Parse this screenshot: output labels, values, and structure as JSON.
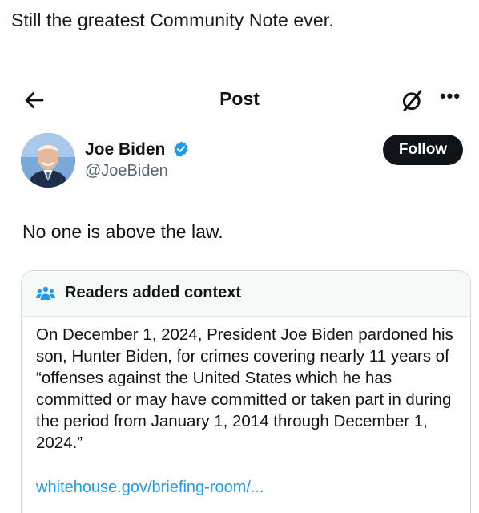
{
  "caption": "Still the greatest Community Note ever.",
  "header": {
    "back_icon": "arrow-left-icon",
    "title": "Post",
    "grok_icon": "grok-icon",
    "more_label": "•••"
  },
  "author": {
    "name": "Joe Biden",
    "handle": "@JoeBiden",
    "verified": true,
    "verified_color": "#1d9bf0",
    "follow_label": "Follow"
  },
  "tweet": {
    "text": "No one is above the law."
  },
  "community_note": {
    "icon": "people-icon",
    "title": "Readers added context",
    "body": "On December 1, 2024, President Joe Biden pardoned his son, Hunter Biden, for crimes covering nearly 11 years of “offenses against the United States which he has committed or may have committed or taken part in during the period from January 1, 2014 through December 1, 2024.”",
    "link": "whitehouse.gov/briefing-room/...",
    "link_color": "#1d9bf0"
  }
}
